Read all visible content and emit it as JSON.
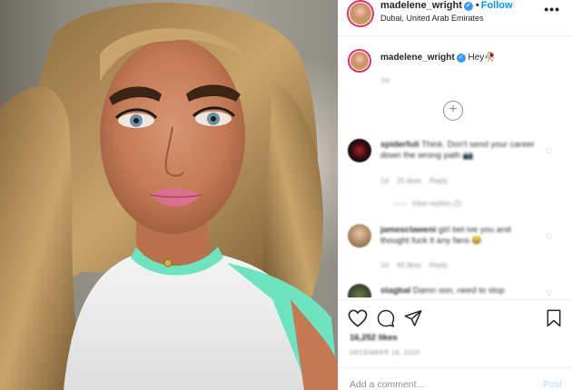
{
  "header": {
    "username": "madelene_wright",
    "verified_icon": "verified-badge-icon",
    "separator": "•",
    "follow_label": "Follow",
    "location": "Dubai, United Arab Emirates",
    "more_label": "•••"
  },
  "caption": {
    "username": "madelene_wright",
    "text": "Hey🥀",
    "time": "1w"
  },
  "comments": [
    {
      "username": "spiderfuli",
      "text": "Think. Don't send your career down the wrong path 📷",
      "time": "1d",
      "likes": "25 likes",
      "reply_label": "Reply",
      "view_replies": "View replies (2)"
    },
    {
      "username": "jamesclaweni",
      "text": "girl bet ive you and thought fuck it any fans 😂",
      "time": "1d",
      "likes": "46 likes",
      "reply_label": "Reply"
    },
    {
      "username": "stagbal",
      "text": "Damn son, need to stop"
    }
  ],
  "load_more_label": "+",
  "footer": {
    "likes": "16,252 likes",
    "date": "DECEMBER 18, 2020",
    "add_comment_placeholder": "Add a comment...",
    "post_label": "Post"
  },
  "colors": {
    "accent": "#0095f6",
    "story_ring": "#e1306c",
    "top_color": "#6fe3c0"
  }
}
